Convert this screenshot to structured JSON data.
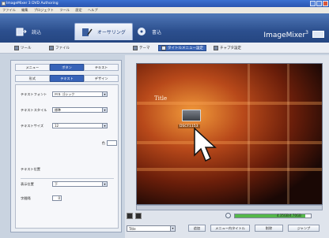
{
  "window": {
    "title": "ImageMixer 3 DVD Authoring"
  },
  "menubar": {
    "items": [
      "ファイル",
      "編集",
      "プロジェクト",
      "ツール",
      "設定",
      "ヘルプ"
    ]
  },
  "tabs": [
    {
      "label": "読込",
      "icon": "import-icon",
      "active": false
    },
    {
      "label": "オーサリング",
      "icon": "authoring-icon",
      "active": true
    },
    {
      "label": "書込",
      "icon": "write-icon",
      "active": false
    }
  ],
  "brand": {
    "name": "ImageMixer",
    "version": "3"
  },
  "subtoolbar": {
    "items": [
      {
        "label": "ツール",
        "icon": "tool-icon",
        "active": false
      },
      {
        "label": "ファイル",
        "icon": "file-icon",
        "active": false
      },
      {
        "label": "テーマ",
        "icon": "theme-icon",
        "active": false
      },
      {
        "label": "タイトルメニュー設定",
        "icon": "title-menu-icon",
        "active": true
      },
      {
        "label": "チャプタ設定",
        "icon": "chapter-icon",
        "active": false
      }
    ]
  },
  "left": {
    "tabs_top": [
      {
        "label": "メニュー",
        "active": false
      },
      {
        "label": "ボタン",
        "active": true
      },
      {
        "label": "テキスト",
        "active": false
      }
    ],
    "tabs_sub": [
      {
        "label": "形式",
        "active": false
      },
      {
        "label": "テキスト",
        "active": true
      },
      {
        "label": "デザイン",
        "active": false
      }
    ],
    "fields": {
      "font_label": "テキストフォント",
      "font_value": "ＭＳ ゴシック",
      "style_label": "テキストスタイル",
      "style_value": "標準",
      "size_label": "テキストサイズ",
      "size_value": "12",
      "color_label": "色"
    },
    "placement": {
      "section_label": "テキスト位置",
      "position_label": "表示位置",
      "position_value": "下",
      "spacing_label": "字間隔",
      "spacing_value": "0"
    }
  },
  "preview": {
    "title_text": "Title",
    "thumb_caption": "DSCF1153"
  },
  "bottom": {
    "meter_label": "4.35GB/4.70GB",
    "meter_fill": 0.93,
    "select_value": "Title",
    "buttons": [
      "追加",
      "メニュー内タイトル",
      "削除",
      "ジャンプ"
    ]
  }
}
